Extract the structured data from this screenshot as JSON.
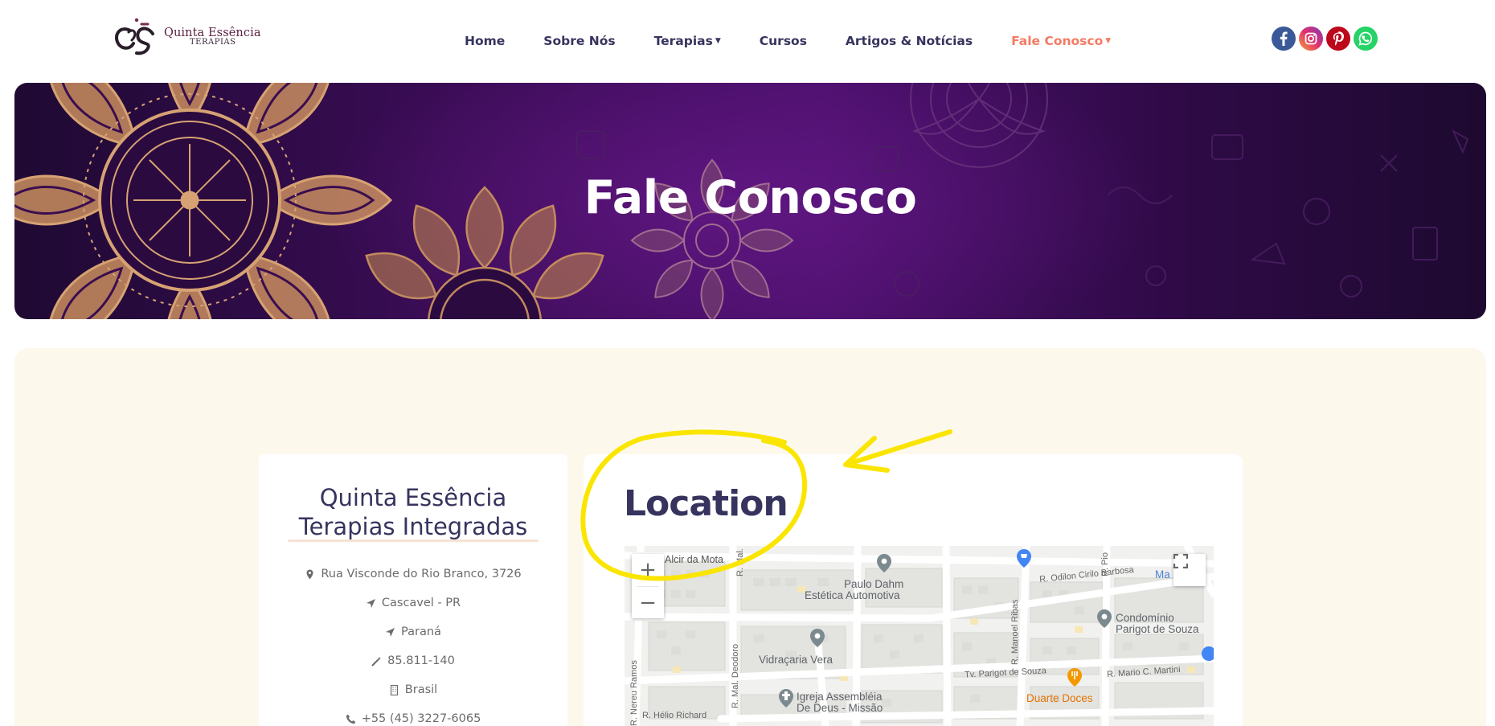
{
  "header": {
    "logo": {
      "name": "Quinta Essência",
      "sub": "TERAPIAS"
    },
    "nav": [
      {
        "label": "Home",
        "has_dropdown": false,
        "active": false
      },
      {
        "label": "Sobre Nós",
        "has_dropdown": false,
        "active": false
      },
      {
        "label": "Terapias",
        "has_dropdown": true,
        "active": false
      },
      {
        "label": "Cursos",
        "has_dropdown": false,
        "active": false
      },
      {
        "label": "Artigos & Notícias",
        "has_dropdown": false,
        "active": false
      },
      {
        "label": "Fale Conosco",
        "has_dropdown": true,
        "active": true
      }
    ],
    "social": [
      {
        "icon": "facebook-icon",
        "color": "#3b5998"
      },
      {
        "icon": "instagram-icon",
        "color": "#c13584"
      },
      {
        "icon": "pinterest-icon",
        "color": "#bd081c"
      },
      {
        "icon": "whatsapp-icon",
        "color": "#25d366"
      }
    ]
  },
  "banner": {
    "title": "Fale Conosco"
  },
  "contact": {
    "org_name_line1": "Quinta Essência",
    "org_name_line2": "Terapias Integradas",
    "items": [
      {
        "icon": "map-pin-icon",
        "text": "Rua Visconde do Rio Branco, 3726"
      },
      {
        "icon": "location-arrow-icon",
        "text": "Cascavel - PR"
      },
      {
        "icon": "location-arrow-icon",
        "text": "Paraná"
      },
      {
        "icon": "magic-wand-icon",
        "text": "85.811-140"
      },
      {
        "icon": "building-icon",
        "text": "Brasil"
      },
      {
        "icon": "phone-icon",
        "text": "+55 (45) 3227-6065"
      }
    ]
  },
  "location": {
    "title": "Location",
    "map": {
      "zoom_in": "+",
      "zoom_out": "−",
      "labels": {
        "alcir": "Alcir da Mota",
        "paulo1": "Paulo Dahm",
        "paulo2": "Estética Automotiva",
        "odilon": "R. Odilon Cirilo Barbosa",
        "condo1": "Condomínio",
        "condo2": "Parigot de Souza",
        "vidracaria": "Vidraçaria Vera",
        "igreja1": "Igreja Assembléia",
        "igreja2": "De Deus - Missão",
        "parigot": "Tv. Parigot de Souza",
        "mario": "R. Mario C. Martini",
        "duarte": "Duarte Doces",
        "helio": "R. Hélio Richard",
        "nereu": "R. Nereu Ramos",
        "deodoro": "R. Mal. Deodoro",
        "manoel": "R. Manoel Ribas",
        "mal": "R. Mal.",
        "pio": "R. Pio",
        "ma": "Ma"
      }
    }
  },
  "colors": {
    "accent": "#f27b63",
    "nav_text": "#36345e",
    "banner": "#4a0f6b",
    "content_bg": "#fdf8ec",
    "annotation": "#fae500"
  }
}
